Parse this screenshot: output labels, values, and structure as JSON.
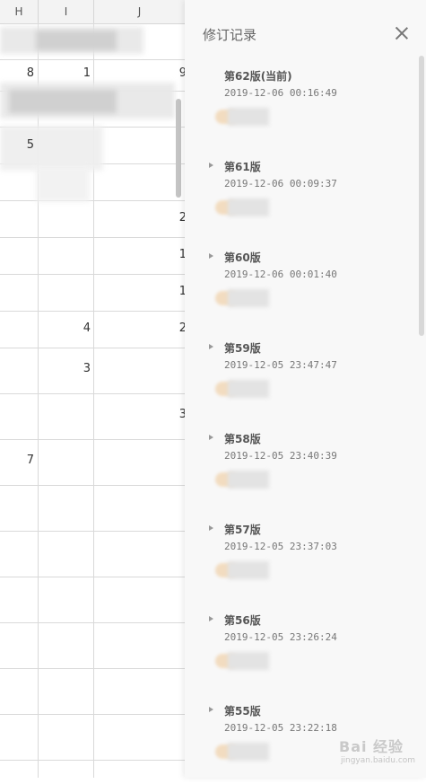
{
  "sheet": {
    "columns": [
      "H",
      "I",
      "J"
    ],
    "cells": {
      "r1h": "8",
      "r1i": "1",
      "r1j": "9",
      "r3h": "5",
      "r6j": "2",
      "r7j": "1",
      "r8j": "1",
      "r9i": "4",
      "r9j": "2",
      "r10i": "3",
      "r11j": "3",
      "r12h": "7"
    }
  },
  "panel": {
    "title": "修订记录",
    "close_icon": "close-icon",
    "versions": [
      {
        "label": "第62版(当前)",
        "time": "2019-12-06 00:16:49",
        "current": true
      },
      {
        "label": "第61版",
        "time": "2019-12-06 00:09:37",
        "current": false
      },
      {
        "label": "第60版",
        "time": "2019-12-06 00:01:40",
        "current": false
      },
      {
        "label": "第59版",
        "time": "2019-12-05 23:47:47",
        "current": false
      },
      {
        "label": "第58版",
        "time": "2019-12-05 23:40:39",
        "current": false
      },
      {
        "label": "第57版",
        "time": "2019-12-05 23:37:03",
        "current": false
      },
      {
        "label": "第56版",
        "time": "2019-12-05 23:26:24",
        "current": false
      },
      {
        "label": "第55版",
        "time": "2019-12-05 23:22:18",
        "current": false
      }
    ]
  },
  "watermark": {
    "text": "Bai 经验",
    "sub": "jingyan.baidu.com"
  }
}
